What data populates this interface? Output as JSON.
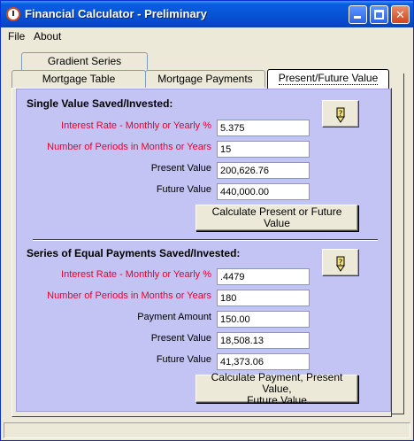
{
  "window": {
    "title": "Financial Calculator  - Preliminary"
  },
  "menu": {
    "file": "File",
    "about": "About"
  },
  "tabs": {
    "gradient_series": "Gradient Series",
    "mortgage_table": "Mortgage Table",
    "mortgage_payments": "Mortgage Payments",
    "present_future_value": "Present/Future Value",
    "active": "Present/Future Value"
  },
  "single_value": {
    "title": "Single Value Saved/Invested:",
    "interest_label": "Interest Rate -  Monthly or Yearly %",
    "interest_value": "5.375",
    "periods_label": "Number of Periods in Months or Years",
    "periods_value": "15",
    "present_label": "Present Value",
    "present_value": "200,626.76",
    "future_label": "Future Value",
    "future_value": "440,000.00",
    "calc_button": "Calculate Present or Future Value"
  },
  "series": {
    "title": "Series of Equal Payments Saved/Invested:",
    "interest_label": "Interest Rate -  Monthly or Yearly %",
    "interest_value": ".4479",
    "periods_label": "Number of Periods in Months or Years",
    "periods_value": "180",
    "payment_label": "Payment Amount",
    "payment_value": "150.00",
    "present_label": "Present Value",
    "present_value": "18,508.13",
    "future_label": "Future Value",
    "future_value": "41,373.06",
    "calc_button_line1": "Calculate Payment, Present Value,",
    "calc_button_line2": "Future Value"
  },
  "icons": {
    "help": "pencil-help-icon",
    "app": "clock-icon"
  },
  "colors": {
    "panel_bg": "#c4c4f4",
    "label_red": "#e8002a",
    "titlebar": "#0854d6"
  }
}
